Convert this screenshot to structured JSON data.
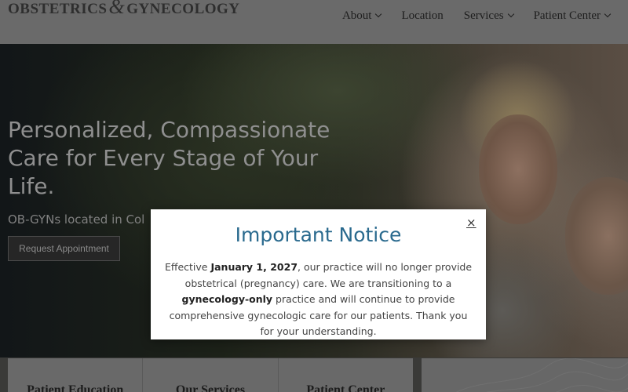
{
  "header": {
    "logo": {
      "line1": "OBSTETRICS",
      "amp": "&",
      "line2": "GYNECOLOGY"
    },
    "nav": [
      {
        "label": "About",
        "dropdown": true
      },
      {
        "label": "Location",
        "dropdown": false
      },
      {
        "label": "Services",
        "dropdown": true
      },
      {
        "label": "Patient Center",
        "dropdown": true
      }
    ]
  },
  "hero": {
    "title": "Personalized, Compassionate Care for Every Stage of Your Life.",
    "subtitle": "OB-GYNs located in Col",
    "cta": "Request Appointment"
  },
  "cards": [
    {
      "label": "Patient Education"
    },
    {
      "label": "Our Services"
    },
    {
      "label": "Patient Center"
    }
  ],
  "modal": {
    "title": "Important Notice",
    "close": "×",
    "body": {
      "part1": "Effective ",
      "bold1": "January 1, 2027",
      "part2": ", our practice will no longer provide obstetrical (pregnancy) care. We are transitioning to a ",
      "bold2": "gynecology-only",
      "part3": " practice and will continue to provide comprehensive gynecologic care for our patients. Thank you for your understanding."
    }
  },
  "colors": {
    "modal_title": "#2a6a8e",
    "overlay": "#000000"
  }
}
